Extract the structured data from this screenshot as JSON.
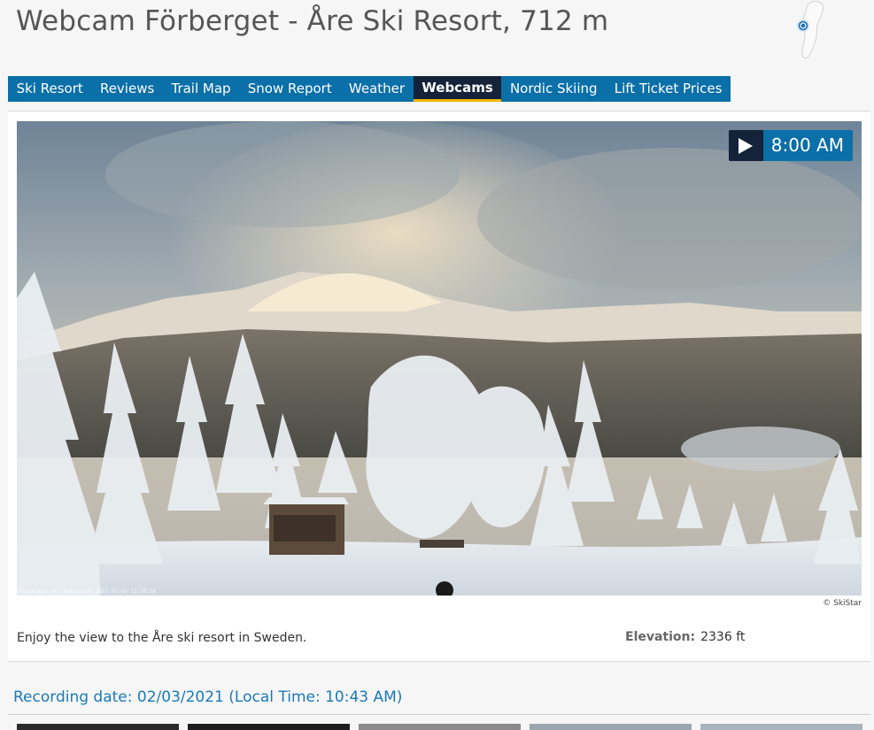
{
  "page": {
    "title": "Webcam Förberget - Åre Ski Resort, 712 m"
  },
  "nav": {
    "items": [
      {
        "label": "Ski Resort"
      },
      {
        "label": "Reviews"
      },
      {
        "label": "Trail Map"
      },
      {
        "label": "Snow Report"
      },
      {
        "label": "Weather"
      },
      {
        "label": "Webcams"
      },
      {
        "label": "Nordic Skiing"
      },
      {
        "label": "Lift Ticket Prices"
      }
    ],
    "active": "Webcams"
  },
  "webcam": {
    "time_label": "8:00 AM",
    "overlay_text": "Förberget mot Åreskutan 2021-02-03 13:59:58",
    "copyright": "© SkiStar"
  },
  "info": {
    "description": "Enjoy the view to the Åre ski resort in Sweden.",
    "elevation_label": "Elevation:",
    "elevation_value": "2336 ft"
  },
  "recording": {
    "text": "Recording date: 02/03/2021 (Local Time: 10:43 AM)"
  },
  "thumbnails": {
    "colors": [
      "#2a2a2a",
      "#1e1e1e",
      "#8a8a8a",
      "#9aa7b0",
      "#a8b4bd"
    ]
  },
  "colors": {
    "nav_bg": "#0b6fa8",
    "nav_active_bg": "#14223a",
    "nav_active_border": "#f2b400",
    "link": "#1a7ab8"
  }
}
